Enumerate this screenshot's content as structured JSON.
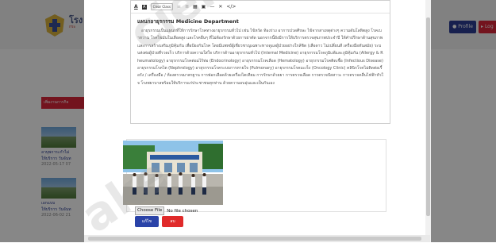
{
  "background": {
    "site_title": "โรง",
    "site_subtitle": "กระ",
    "profile_button": "Profile",
    "logout_button": "Log",
    "red_bar_label": "เพิ่มงานการกิจ",
    "cards": [
      {
        "line1": "ลาบุพการะกำไม่",
        "line2": "ให้บริการ วันจันท",
        "date": "2022-05-17 07"
      },
      {
        "line1": "เอกแบบ",
        "line2": "ให้บริการ วันจันท",
        "date": "2022-06-02 21"
      }
    ]
  },
  "toolbar": {
    "bold": "A",
    "highlight": "A",
    "clear_format": "Clear Class",
    "ul": "≡",
    "ol": "≣",
    "table": "▦",
    "hr": "—",
    "close": "✕",
    "code": "</>"
  },
  "editor": {
    "title": "แผนกอายุรกรรม Medicine Department",
    "text": "อายุรกรรมเป็นแผนกที่ให้การรักษาโรคทางอายุรกรรมทั่วไป เช่น ไข้หวัด ท้องร่วง อาการปวดศีรษะ ไข้จากสาเหตุต่างๆ ความดันโลหิตสูง โรคเบาหวาน โรคไขมันในเลือดสูง และโรคอื่นๆ ที่ไม่ต้องรักษาด้วยการผ่าตัด นอกจากนี้ยังมีการให้บริการตรวจสุขภาพประจำปี ให้คำปรึกษาด้านสุขภาพ และการสร้างเสริมภูมิคุ้มกัน เพื่อป้องกันโรค โดยมีแพทย์ผู้เชี่ยวชาญเฉพาะทางดูแลผู้ป่วยอย่างใกล้ชิด (เสือดาว ไม่เปลี่ยนสี เครื่องมือทันสมัย) ระบบส่งต่อผู้ป่วยที่รวดเร็ว บริการด้วยความใส่ใจ บริการด้านอายุรกรรมทั่วไป (Internal Medicine) อายุรกรรมโรคภูมิแพ้และภูมิคุ้มกัน (Allergy & Rheumatology) อายุรกรรมโรคต่อมไร้ท่อ (Endocrinology) อายุรกรรมโรคเลือด (Hematology) อายุรกรรมโรคติดเชื้อ (Infectious Disease) อายุรกรรมโรคไต (Nephrology) อายุรกรรมโรคระบบการหายใจ (Pulmonary) อายุรกรรมโรคมะเร็ง (Oncology Clinic) คลินิกโรคไม่ติดต่อเรื้อรัง / เครื่องมือ / ห้องตรวจมาตรฐาน การฟอกเลือดด้วยเครื่องไตเทียม การรักษาด้วยยา การตรวจเลือด การตรวจปัสสาวะ การตรวจคลื่นไฟฟ้าหัวใจ โรงพยาบาลพร้อมให้บริการแก่ประชาชนทุกท่าน ด้วยความอบอุ่นและเป็นกันเอง"
  },
  "upload": {
    "choose_file": "Choose File",
    "no_file": "No file chosen",
    "save_button": "แก้ไข",
    "cancel_button": "ลบ"
  },
  "watermark": {
    "line1": "cien",
    "line2": "ake"
  },
  "colors": {
    "primary": "#2a43a8",
    "danger": "#e02a2a",
    "overlay": "#000000"
  }
}
